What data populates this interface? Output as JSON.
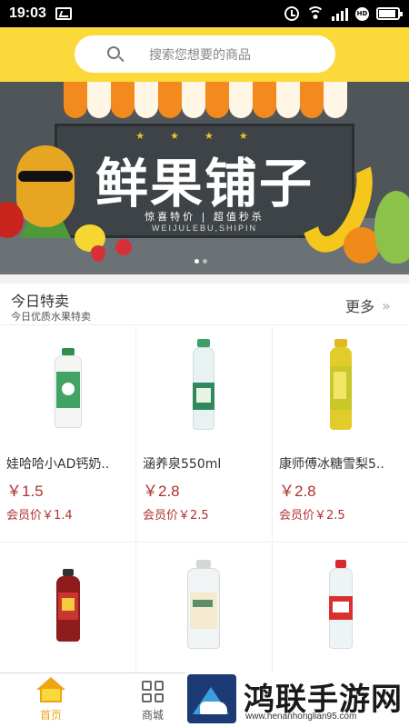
{
  "status_bar": {
    "time": "19:03",
    "icons": [
      "image-icon",
      "alarm-icon",
      "wifi-icon",
      "signal-icon",
      "hd-icon",
      "battery-icon"
    ]
  },
  "search": {
    "placeholder": "搜索您想要的商品"
  },
  "banner": {
    "title": "鲜果铺子",
    "subtitle": "惊喜特价 | 超值秒杀",
    "pinyin": "WEIJULEBU,SHIPIN",
    "slide_count": 2,
    "active_slide": 1
  },
  "section": {
    "title": "今日特卖",
    "subtitle": "今日优质水果特卖",
    "more_label": "更多",
    "more_arrow": "»"
  },
  "products": [
    {
      "name": "娃哈哈小AD钙奶..",
      "price": "￥1.5",
      "member_price": "会员价￥1.4",
      "image": "wahaha-ad-milk-bottle"
    },
    {
      "name": "涵养泉550ml",
      "price": "￥2.8",
      "member_price": "会员价￥2.5",
      "image": "hanyangquan-water-bottle"
    },
    {
      "name": "康师傅冰糖雪梨5..",
      "price": "￥2.8",
      "member_price": "会员价￥2.5",
      "image": "kangshifu-pear-drink-bottle"
    },
    {
      "name": "",
      "price": "",
      "member_price": "",
      "image": "red-tea-drink-bottle"
    },
    {
      "name": "",
      "price": "",
      "member_price": "",
      "image": "water-bottle-label"
    },
    {
      "name": "",
      "price": "",
      "member_price": "",
      "image": "nongfu-spring-bottle"
    }
  ],
  "tabs": [
    {
      "label": "首页",
      "icon": "home-icon",
      "active": true
    },
    {
      "label": "商城",
      "icon": "grid-icon",
      "active": false
    }
  ],
  "watermark": {
    "title": "鸿联手游网",
    "url": "www.henanhonglian95.com"
  },
  "colors": {
    "accent_yellow": "#fcd93b",
    "price_red": "#b0312f",
    "active_tab": "#f0a414"
  }
}
